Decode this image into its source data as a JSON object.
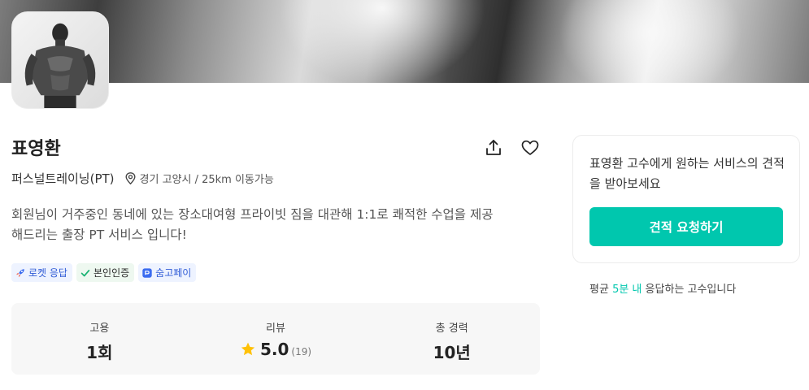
{
  "profile": {
    "name": "표영환",
    "service": "퍼스널트레이닝(PT)",
    "location": "경기 고양시 / 25km 이동가능",
    "intro": "회원님이 거주중인 동네에 있는 장소대여형 프라이빗 짐을 대관해 1:1로 쾌적한 수업을 제공해드리는 출장 PT 서비스 입니다!"
  },
  "badges": [
    {
      "label": "로켓 응답",
      "icon": "rocket-icon"
    },
    {
      "label": "본인인증",
      "icon": "check-icon"
    },
    {
      "label": "숨고페이",
      "icon": "pay-icon"
    }
  ],
  "stats": {
    "hire": {
      "label": "고용",
      "value": "1회"
    },
    "review": {
      "label": "리뷰",
      "value": "5.0",
      "count": "(19)"
    },
    "career": {
      "label": "총 경력",
      "value": "10년"
    }
  },
  "quote": {
    "text": "표영환 고수에게 원하는 서비스의 견적을 받아보세요",
    "button": "견적 요청하기"
  },
  "response": {
    "prefix": "평균",
    "highlight": "5분 내",
    "suffix": "응답하는 고수입니다"
  },
  "colors": {
    "accent": "#00c7ae",
    "star": "#ffc107",
    "badge_blue": "#2f5bd6",
    "check_green": "#19b373"
  }
}
